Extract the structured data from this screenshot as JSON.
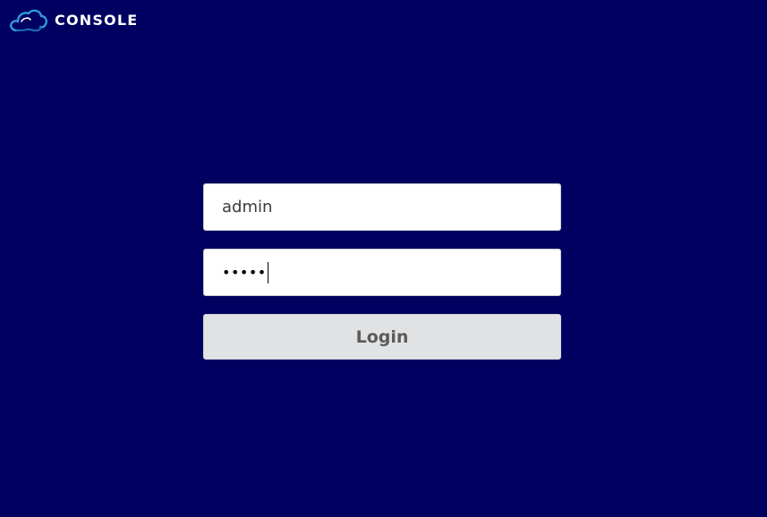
{
  "header": {
    "logo_icon": "cloud-icon",
    "brand_text": "CONSOLE"
  },
  "login": {
    "username_value": "admin",
    "password_mask": "•••••",
    "login_label": "Login"
  },
  "colors": {
    "background": "#000060",
    "logo_blue": "#2f9bdf",
    "button_gray": "#e1e2e4"
  }
}
